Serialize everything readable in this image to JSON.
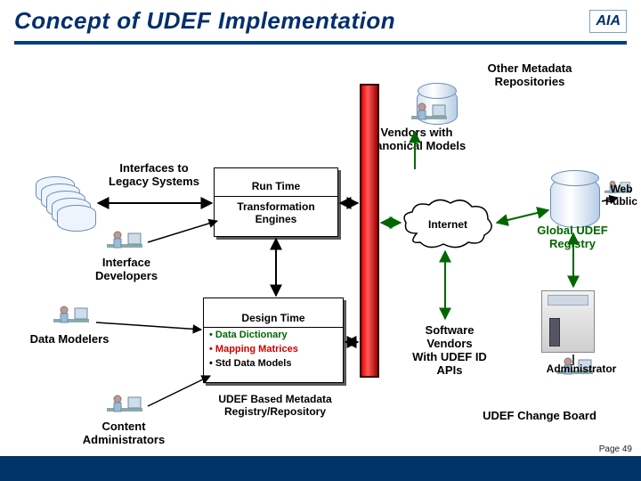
{
  "slide": {
    "title": "Concept of UDEF Implementation",
    "logo_text": "AIA",
    "page_label": "Page 49"
  },
  "labels": {
    "other_metadata": "Other Metadata\nRepositories",
    "vendors_canonical": "Vendors with\nCanonical Models",
    "interfaces_legacy": "Interfaces to\nLegacy Systems",
    "run_time": "Run Time",
    "transformation_engines": "Transformation\nEngines",
    "internet": "Internet",
    "global_udef_registry": "Global UDEF\nRegistry",
    "web_public": "Web\nPublic",
    "interface_developers": "Interface\nDevelopers",
    "design_time": "Design Time",
    "data_dictionary": "• Data Dictionary",
    "mapping_matrices": "• Mapping Matrices",
    "std_data_models": "• Std Data Models",
    "udef_metadata_repo": "UDEF Based Metadata\nRegistry/Repository",
    "data_modelers": "Data Modelers",
    "content_admins": "Content\nAdministrators",
    "software_vendors_api": "Software\nVendors\nWith UDEF ID\nAPIs",
    "administrator": "Administrator",
    "udef_change_board": "UDEF Change Board"
  },
  "colors": {
    "title": "#002f6c",
    "rule": "#003e7e",
    "green": "#006600",
    "red": "#cc0000",
    "footer_band": "#003366"
  }
}
